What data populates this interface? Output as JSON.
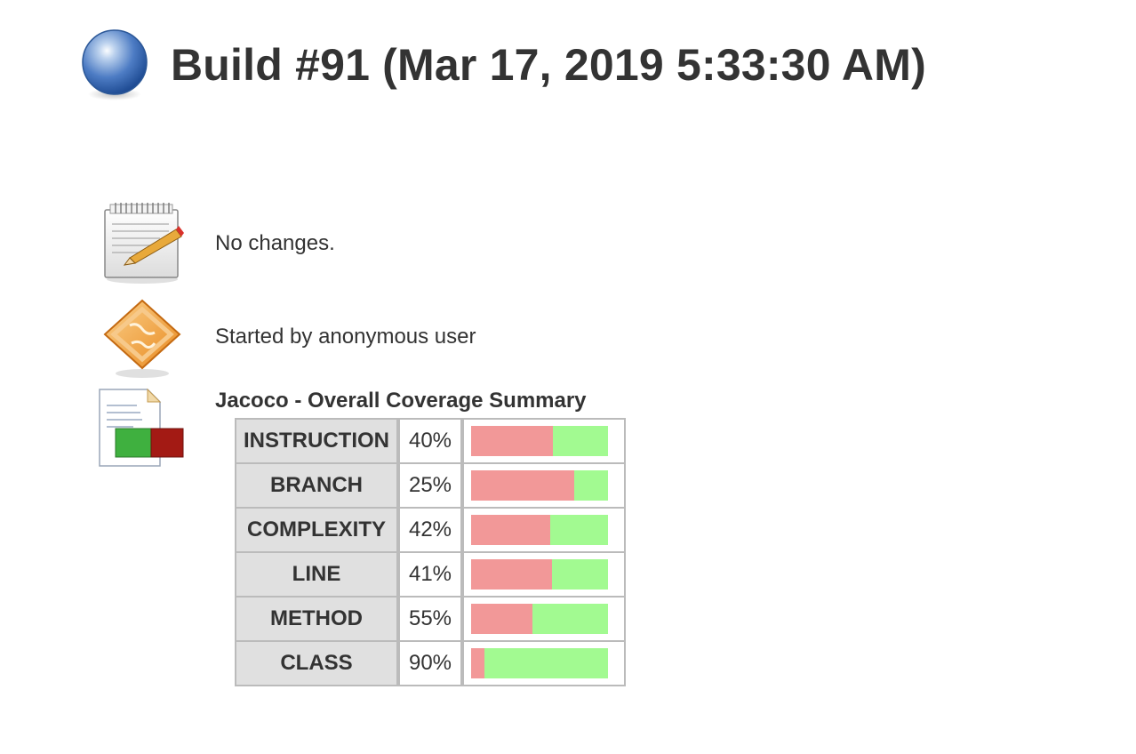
{
  "header": {
    "title": "Build #91 (Mar 17, 2019 5:33:30 AM)",
    "status_icon": "blue-ball-icon"
  },
  "summary": {
    "changes_text": "No changes.",
    "changes_icon": "notepad-icon",
    "cause_text": "Started by anonymous user",
    "cause_icon": "user-cause-icon"
  },
  "coverage": {
    "title": "Jacoco - Overall Coverage Summary",
    "icon": "coverage-report-icon",
    "colors": {
      "covered": "#a2fa91",
      "missed": "#f29898"
    },
    "rows": [
      {
        "name": "INSTRUCTION",
        "percent": "40%",
        "covered_fraction": 0.4
      },
      {
        "name": "BRANCH",
        "percent": "25%",
        "covered_fraction": 0.25
      },
      {
        "name": "COMPLEXITY",
        "percent": "42%",
        "covered_fraction": 0.42
      },
      {
        "name": "LINE",
        "percent": "41%",
        "covered_fraction": 0.41
      },
      {
        "name": "METHOD",
        "percent": "55%",
        "covered_fraction": 0.55
      },
      {
        "name": "CLASS",
        "percent": "90%",
        "covered_fraction": 0.9
      }
    ]
  }
}
